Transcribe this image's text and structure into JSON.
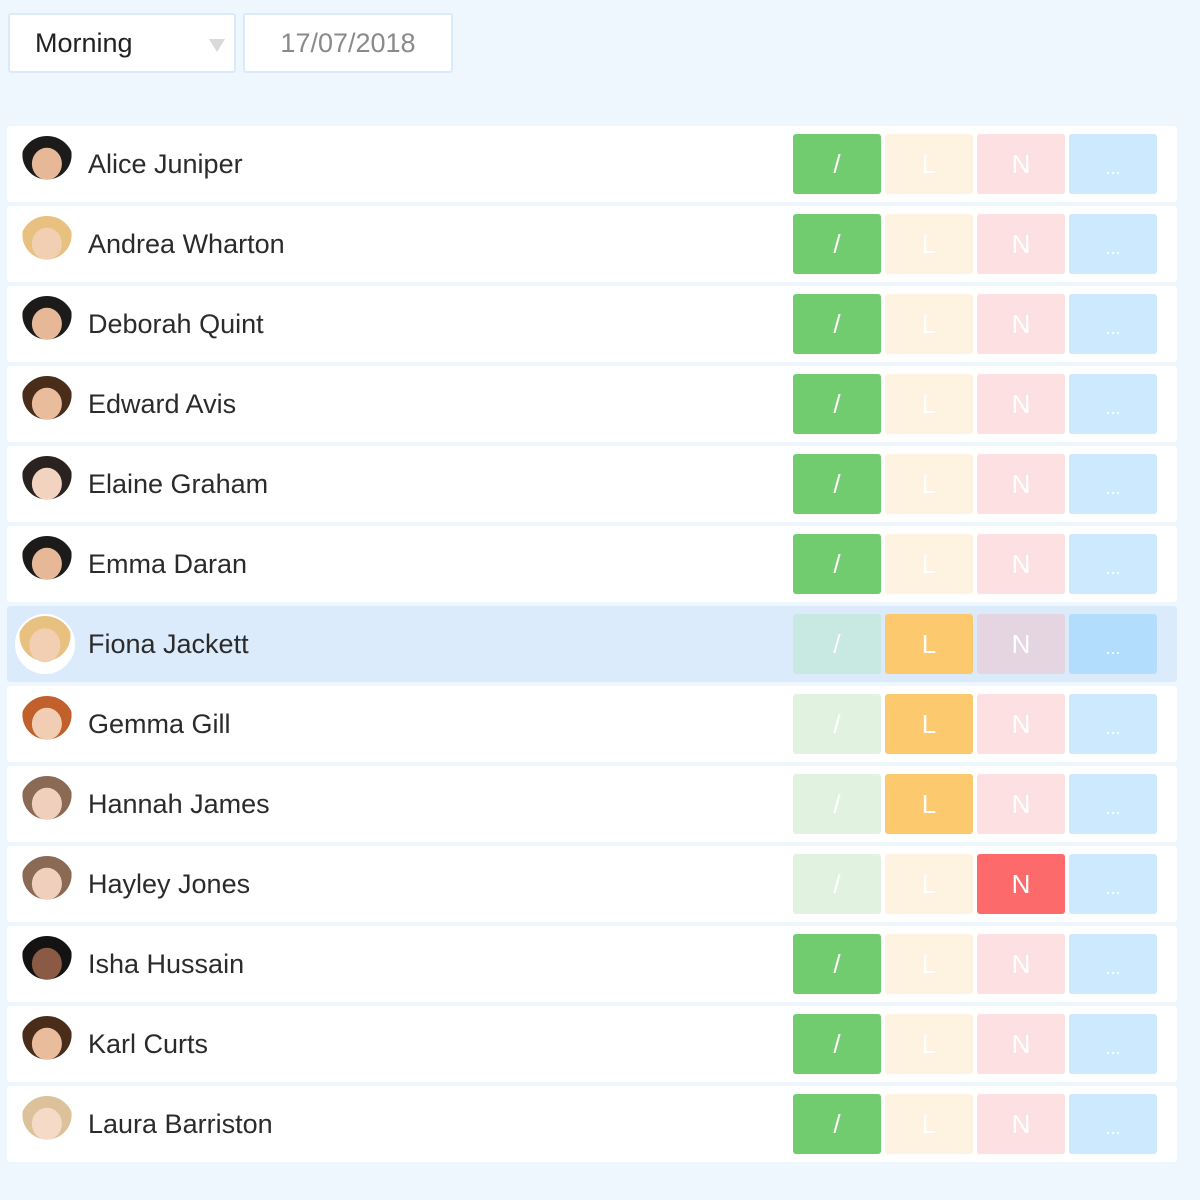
{
  "toolbar": {
    "session_select": {
      "value": "Morning"
    },
    "date_field": {
      "value": "17/07/2018"
    }
  },
  "buttons": {
    "present": "/",
    "late": "L",
    "absent": "N",
    "more": "..."
  },
  "colors": {
    "present_active": "#71cb6f",
    "present_inactive": "#e1f2e1",
    "present_inactive_selected": "#c8e8e2",
    "late_active": "#fdc96e",
    "late_inactive": "#fef3e0",
    "absent_active": "#fc6a6b",
    "absent_inactive": "#fde0e1",
    "absent_inactive_selected": "#e4d5e1",
    "more_inactive": "#cde9fd",
    "more_selected": "#b3ddfd",
    "row_selected": "#dcebfc"
  },
  "students": [
    {
      "name": "Alice Juniper",
      "status": "present",
      "avatar": "dark-curly-hair-girl"
    },
    {
      "name": "Andrea Wharton",
      "status": "present",
      "avatar": "blonde-girl"
    },
    {
      "name": "Deborah Quint",
      "status": "present",
      "avatar": "dark-curly-hair-girl"
    },
    {
      "name": "Edward Avis",
      "status": "present",
      "avatar": "brown-curly-hair-boy"
    },
    {
      "name": "Elaine Graham",
      "status": "present",
      "avatar": "dark-hair-girl"
    },
    {
      "name": "Emma Daran",
      "status": "present",
      "avatar": "dark-curly-hair-girl"
    },
    {
      "name": "Fiona Jackett",
      "status": "late",
      "avatar": "blonde-girl",
      "selected": true
    },
    {
      "name": "Gemma Gill",
      "status": "late",
      "avatar": "red-hair-girl"
    },
    {
      "name": "Hannah James",
      "status": "late",
      "avatar": "brown-hair-girl"
    },
    {
      "name": "Hayley Jones",
      "status": "absent",
      "avatar": "brown-hair-girl"
    },
    {
      "name": "Isha Hussain",
      "status": "present",
      "avatar": "black-long-hair-girl"
    },
    {
      "name": "Karl Curts",
      "status": "present",
      "avatar": "brown-curly-hair-boy"
    },
    {
      "name": "Laura Barriston",
      "status": "present",
      "avatar": "light-blonde-girl"
    }
  ]
}
